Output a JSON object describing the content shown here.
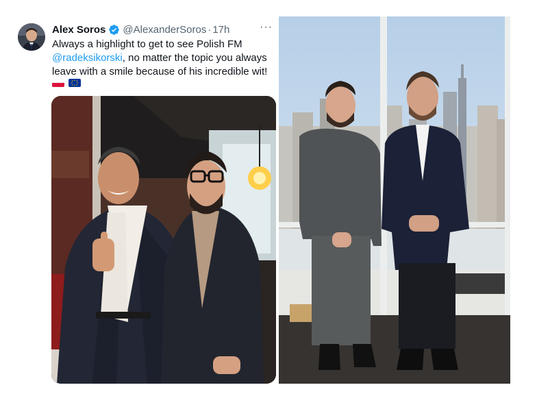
{
  "tweet": {
    "display_name": "Alex Soros",
    "handle": "@AlexanderSoros",
    "separator": "·",
    "time": "17h",
    "more_icon": "···",
    "text_part1": "Always a highlight to get to see Polish FM ",
    "mention": "@radeksikorski",
    "text_part2": ", no matter the topic you always leave with a smile because of his incredible wit!",
    "flags": [
      "poland-flag",
      "eu-flag"
    ]
  },
  "colors": {
    "accent": "#1d9bf0",
    "text": "#0f1419",
    "secondary": "#536471"
  }
}
